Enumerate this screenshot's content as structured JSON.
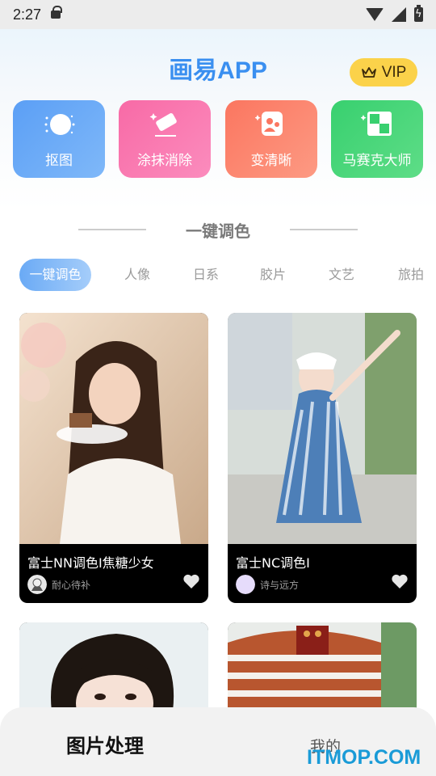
{
  "status_bar": {
    "time": "2:27"
  },
  "header": {
    "app_title": "画易APP",
    "vip_label": "VIP"
  },
  "tools": [
    {
      "label": "抠图",
      "icon": "cutout-icon"
    },
    {
      "label": "涂抹消除",
      "icon": "eraser-icon"
    },
    {
      "label": "变清晰",
      "icon": "enhance-icon"
    },
    {
      "label": "马赛克大师",
      "icon": "mosaic-icon"
    }
  ],
  "section": {
    "title": "一键调色"
  },
  "tabs": [
    "一键调色",
    "人像",
    "日系",
    "胶片",
    "文艺",
    "旅拍"
  ],
  "active_tab": "一键调色",
  "cards": [
    {
      "title": "富士NN调色I焦糖少女",
      "author": "耐心待补"
    },
    {
      "title": "富士NC调色I",
      "author": "诗与远方"
    }
  ],
  "bottom_nav": {
    "process_label": "图片处理",
    "mine_label": "我的"
  },
  "watermark": "ITMOP.COM",
  "colors": {
    "brand_blue": "#3a8ff0",
    "vip_yellow": "#fbd24a",
    "tool_blue": "#5b9ff5",
    "tool_pink": "#f86aa6",
    "tool_coral": "#fb7660",
    "tool_green": "#38d06f"
  }
}
